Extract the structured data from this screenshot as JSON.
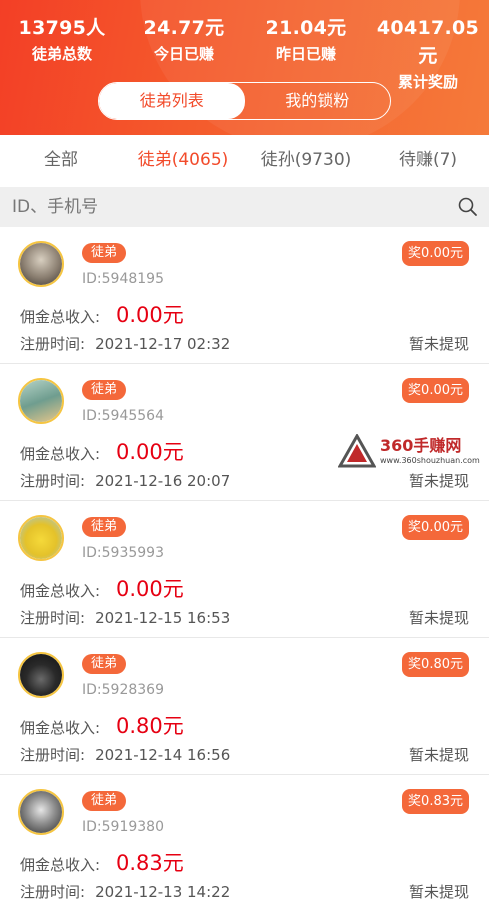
{
  "stats": [
    {
      "value": "13795人",
      "label": "徒弟总数"
    },
    {
      "value": "24.77元",
      "label": "今日已赚"
    },
    {
      "value": "21.04元",
      "label": "昨日已赚"
    },
    {
      "value": "40417.05元",
      "label": "累计奖励"
    }
  ],
  "segment": {
    "left": "徒弟列表",
    "right": "我的锁粉"
  },
  "tabs": [
    "全部",
    "徒弟(4065)",
    "徒孙(9730)",
    "待赚(7)"
  ],
  "search": {
    "placeholder": "ID、手机号",
    "icon": "search-icon"
  },
  "list_labels": {
    "income": "佣金总收入:",
    "reg_prefix": "注册时间:"
  },
  "records": [
    {
      "badge": "徒弟",
      "id": "ID:5948195",
      "reward": "奖0.00元",
      "income": "0.00元",
      "reg": "2021-12-17 02:32",
      "status": "暂未提现"
    },
    {
      "badge": "徒弟",
      "id": "ID:5945564",
      "reward": "奖0.00元",
      "income": "0.00元",
      "reg": "2021-12-16 20:07",
      "status": "暂未提现"
    },
    {
      "badge": "徒弟",
      "id": "ID:5935993",
      "reward": "奖0.00元",
      "income": "0.00元",
      "reg": "2021-12-15 16:53",
      "status": "暂未提现"
    },
    {
      "badge": "徒弟",
      "id": "ID:5928369",
      "reward": "奖0.80元",
      "income": "0.80元",
      "reg": "2021-12-14 16:56",
      "status": "暂未提现"
    },
    {
      "badge": "徒弟",
      "id": "ID:5919380",
      "reward": "奖0.83元",
      "income": "0.83元",
      "reg": "2021-12-13 14:22",
      "status": "暂未提现"
    }
  ],
  "watermark": {
    "title": "360手赚网",
    "url": "www.360shouzhuan.com"
  },
  "colors": {
    "accent": "#f24b2b",
    "badge": "#f4683a",
    "income": "#e60012"
  }
}
